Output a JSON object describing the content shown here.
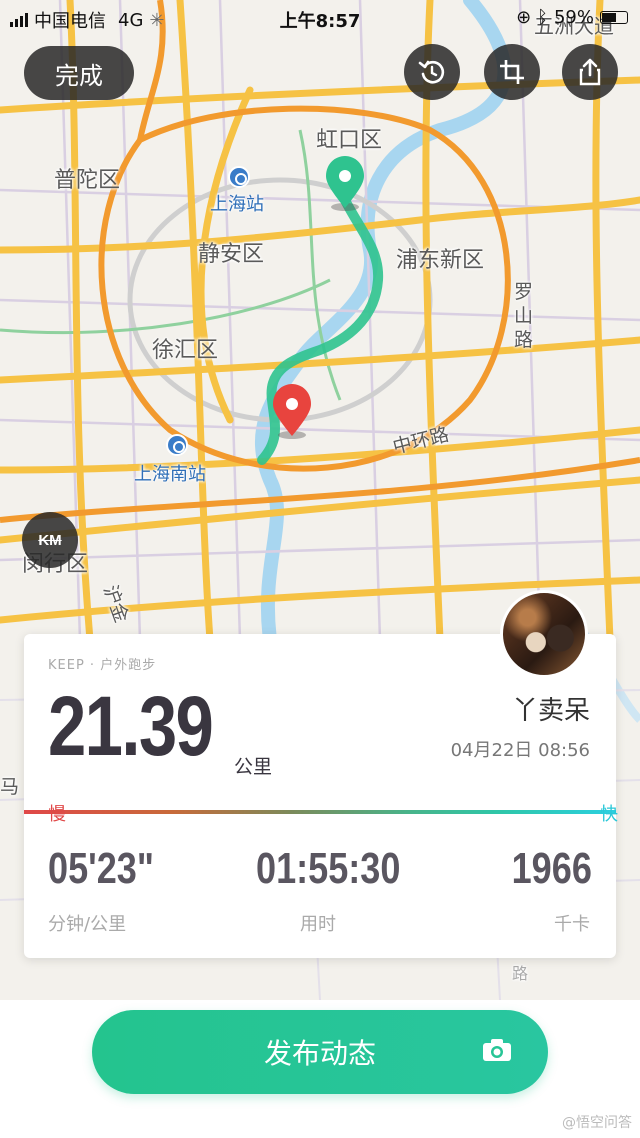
{
  "status_bar": {
    "carrier": "中国电信",
    "network": "4G",
    "time": "上午8:57",
    "battery": "59%"
  },
  "top_bar": {
    "done_label": "完成",
    "history_icon": "history-icon",
    "crop_icon": "crop-icon",
    "share_icon": "share-icon"
  },
  "map": {
    "labels": {
      "hongkou": "虹口区",
      "putuo": "普陀区",
      "shanghai_station": "上海站",
      "jingan": "静安区",
      "pudong": "浦东新区",
      "luoshan": "罗山路",
      "xuhui": "徐汇区",
      "shanghai_south": "上海南站",
      "zhonghuan": "中环路",
      "minhang": "闵行区",
      "wuzhou": "五洲大道",
      "hujin": "沪金",
      "ma": "马",
      "lu": "路"
    },
    "km_label": "KM",
    "route_color": "#2fc38f",
    "start_marker_color": "#2fc38f",
    "end_marker_color": "#e8443e"
  },
  "card": {
    "source": "KEEP · 户外跑步",
    "distance": "21.39",
    "unit": "公里",
    "username": "丫卖呆",
    "datetime": "04月22日 08:56",
    "pace_slow": "慢",
    "pace_fast": "快",
    "stats": [
      {
        "value": "05'23\"",
        "label": "分钟/公里"
      },
      {
        "value": "01:55:30",
        "label": "用时"
      },
      {
        "value": "1966",
        "label": "千卡"
      }
    ]
  },
  "publish": {
    "label": "发布动态",
    "camera_icon": "camera-icon"
  },
  "watermark": "@悟空问答",
  "colors": {
    "accent": "#24c48e",
    "slow": "#e04848",
    "fast": "#2bc8d8",
    "road_major": "#f6c244",
    "river": "#a8d6f0"
  }
}
